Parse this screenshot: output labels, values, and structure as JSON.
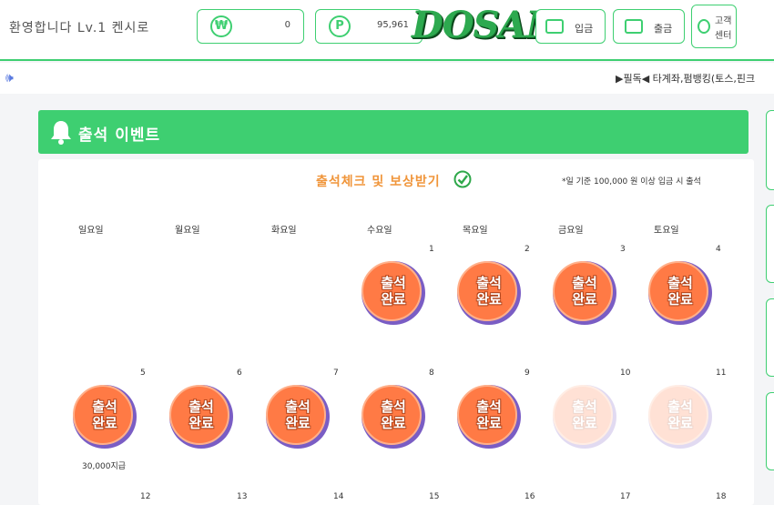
{
  "header": {
    "welcome": "환영합니다  Lv.1 켄시로",
    "balance_symbol": "₩",
    "balance": "0",
    "point_symbol": "P",
    "points": "95,961",
    "logo": "DOSAN",
    "deposit_label": "입금",
    "withdraw_label": "출금",
    "support_label_1": "고객",
    "support_label_2": "센터"
  },
  "ticker": {
    "text": "▶필독◀ 타계좌,펌뱅킹(토스,핀크"
  },
  "event": {
    "title": "출석 이벤트",
    "card_title": "출석체크 및 보상받기",
    "note": "*일 기준 100,000 원 이상 입금 시 출석",
    "weekdays": [
      "일요일",
      "월요일",
      "화요일",
      "수요일",
      "목요일",
      "금요일",
      "토요일"
    ],
    "stamp_line1": "출석",
    "stamp_line2": "완료",
    "days": [
      {
        "num": "1",
        "status": "done"
      },
      {
        "num": "2",
        "status": "done"
      },
      {
        "num": "3",
        "status": "done"
      },
      {
        "num": "4",
        "status": "done"
      },
      {
        "num": "5",
        "status": "done",
        "reward": "30,000지급"
      },
      {
        "num": "6",
        "status": "done"
      },
      {
        "num": "7",
        "status": "done"
      },
      {
        "num": "8",
        "status": "done"
      },
      {
        "num": "9",
        "status": "done"
      },
      {
        "num": "10",
        "status": "pending"
      },
      {
        "num": "11",
        "status": "pending"
      },
      {
        "num": "12"
      },
      {
        "num": "13"
      },
      {
        "num": "14"
      },
      {
        "num": "15"
      },
      {
        "num": "16"
      },
      {
        "num": "17"
      },
      {
        "num": "18"
      }
    ]
  },
  "colors": {
    "accent": "#3ecf71",
    "stamp": "#ff7a45",
    "stamp_ring": "#7a5dc4",
    "title_orange": "#f0953a"
  }
}
